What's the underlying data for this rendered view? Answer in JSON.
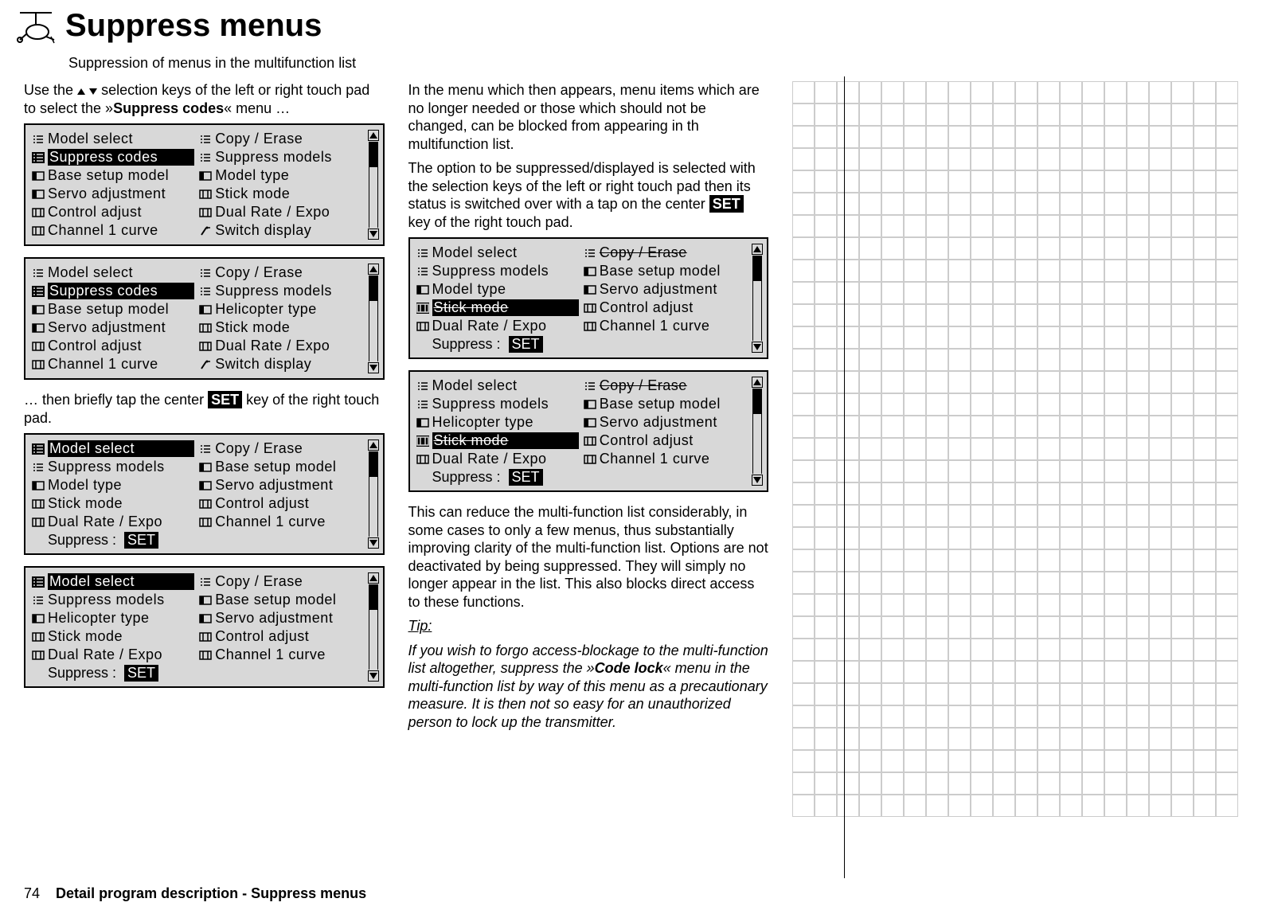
{
  "title": "Suppress menus",
  "subtitle": "Suppression of menus in the multifunction list",
  "intro_col1_p1a": "Use the ",
  "intro_col1_p1b": " selection keys of the left or right touch pad to select the »",
  "intro_col1_p1_bold": "Suppress codes",
  "intro_col1_p1c": "« menu …",
  "intro_col1_p2a": "… then briefly tap the center ",
  "intro_col1_p2_set": "SET",
  "intro_col1_p2b": " key of the right touch pad.",
  "col2_p1": "In the menu which then appears, menu items which are no longer needed or those which should not be changed, can be blocked from appearing in th multifunction list.",
  "col2_p2a": "The option to be suppressed/displayed is selected with the selection keys of the left or right touch pad then its status is switched over with a tap on the center ",
  "col2_p2_set": "SET",
  "col2_p2b": " key of the right touch pad.",
  "col2_p3": "This can reduce the multi-function list considerably, in some cases to only a few menus, thus substantially improving clarity of the multi-function list. Options are not deactivated by being suppressed. They will simply no longer appear in the list. This also blocks direct access to these functions.",
  "tip_label": "Tip:",
  "tip_body_a": "If you wish to forgo access-blockage to the multi-function list altogether, suppress the »",
  "tip_body_bold": "Code lock",
  "tip_body_b": "« menu in the multi-function list by way of this menu as a precautionary measure. It is then not so easy for an unauthorized person to lock up the transmitter.",
  "page_no": "74",
  "footer_text": "Detail program description - Suppress menus",
  "suppress_label": "Suppress :",
  "set_btn": "SET",
  "panels": {
    "p1": {
      "items": [
        {
          "i": "list",
          "t": "Model select"
        },
        {
          "i": "list",
          "t": "Copy / Erase"
        },
        {
          "i": "list",
          "t": "Suppress codes",
          "inv": true
        },
        {
          "i": "list",
          "t": "Suppress models"
        },
        {
          "i": "box",
          "t": "Base setup model"
        },
        {
          "i": "box",
          "t": "Model type"
        },
        {
          "i": "box",
          "t": "Servo adjustment"
        },
        {
          "i": "bars",
          "t": "Stick mode"
        },
        {
          "i": "bars",
          "t": "Control adjust"
        },
        {
          "i": "bars",
          "t": "Dual Rate / Expo"
        },
        {
          "i": "bars",
          "t": "Channel 1 curve"
        },
        {
          "i": "sw",
          "t": "Switch display"
        }
      ],
      "thumb_top": 0,
      "thumb_h": 30
    },
    "p2": {
      "items": [
        {
          "i": "list",
          "t": "Model select"
        },
        {
          "i": "list",
          "t": "Copy / Erase"
        },
        {
          "i": "list",
          "t": "Suppress codes",
          "inv": true
        },
        {
          "i": "list",
          "t": "Suppress models"
        },
        {
          "i": "box",
          "t": "Base setup model"
        },
        {
          "i": "box",
          "t": "Helicopter type"
        },
        {
          "i": "box",
          "t": "Servo adjustment"
        },
        {
          "i": "bars",
          "t": "Stick mode"
        },
        {
          "i": "bars",
          "t": "Control adjust"
        },
        {
          "i": "bars",
          "t": "Dual Rate / Expo"
        },
        {
          "i": "bars",
          "t": "Channel 1 curve"
        },
        {
          "i": "sw",
          "t": "Switch display"
        }
      ],
      "thumb_top": 0,
      "thumb_h": 30
    },
    "p3": {
      "items": [
        {
          "i": "list",
          "t": "Model select",
          "inv": true
        },
        {
          "i": "list",
          "t": "Copy / Erase"
        },
        {
          "i": "list",
          "t": "Suppress models"
        },
        {
          "i": "box",
          "t": "Base setup model"
        },
        {
          "i": "box",
          "t": "Model type"
        },
        {
          "i": "box",
          "t": "Servo adjustment"
        },
        {
          "i": "bars",
          "t": "Stick mode"
        },
        {
          "i": "bars",
          "t": "Control adjust"
        },
        {
          "i": "bars",
          "t": "Dual Rate / Expo"
        },
        {
          "i": "bars",
          "t": "Channel 1 curve"
        }
      ],
      "show_suppress": true,
      "thumb_top": 0,
      "thumb_h": 30
    },
    "p4": {
      "items": [
        {
          "i": "list",
          "t": "Model select",
          "inv": true
        },
        {
          "i": "list",
          "t": "Copy / Erase"
        },
        {
          "i": "list",
          "t": "Suppress models"
        },
        {
          "i": "box",
          "t": "Base setup model"
        },
        {
          "i": "box",
          "t": "Helicopter type"
        },
        {
          "i": "box",
          "t": "Servo adjustment"
        },
        {
          "i": "bars",
          "t": "Stick mode"
        },
        {
          "i": "bars",
          "t": "Control adjust"
        },
        {
          "i": "bars",
          "t": "Dual Rate / Expo"
        },
        {
          "i": "bars",
          "t": "Channel 1 curve"
        }
      ],
      "show_suppress": true,
      "thumb_top": 0,
      "thumb_h": 30
    },
    "p5": {
      "items": [
        {
          "i": "list",
          "t": "Model select"
        },
        {
          "i": "list",
          "t": "Copy / Erase",
          "strike": true
        },
        {
          "i": "list",
          "t": "Suppress models"
        },
        {
          "i": "box",
          "t": "Base setup model"
        },
        {
          "i": "box",
          "t": "Model type"
        },
        {
          "i": "box",
          "t": "Servo adjustment"
        },
        {
          "i": "bars",
          "t": "Stick mode",
          "inv": true,
          "strike": true
        },
        {
          "i": "bars",
          "t": "Control adjust"
        },
        {
          "i": "bars",
          "t": "Dual Rate / Expo"
        },
        {
          "i": "bars",
          "t": "Channel 1 curve"
        }
      ],
      "show_suppress": true,
      "thumb_top": 0,
      "thumb_h": 30
    },
    "p6": {
      "items": [
        {
          "i": "list",
          "t": "Model select"
        },
        {
          "i": "list",
          "t": "Copy / Erase",
          "strike": true
        },
        {
          "i": "list",
          "t": "Suppress models"
        },
        {
          "i": "box",
          "t": "Base setup model"
        },
        {
          "i": "box",
          "t": "Helicopter type"
        },
        {
          "i": "box",
          "t": "Servo adjustment"
        },
        {
          "i": "bars",
          "t": "Stick mode",
          "inv": true,
          "strike": true
        },
        {
          "i": "bars",
          "t": "Control adjust"
        },
        {
          "i": "bars",
          "t": "Dual Rate / Expo"
        },
        {
          "i": "bars",
          "t": "Channel 1 curve"
        }
      ],
      "show_suppress": true,
      "thumb_top": 0,
      "thumb_h": 30
    }
  }
}
